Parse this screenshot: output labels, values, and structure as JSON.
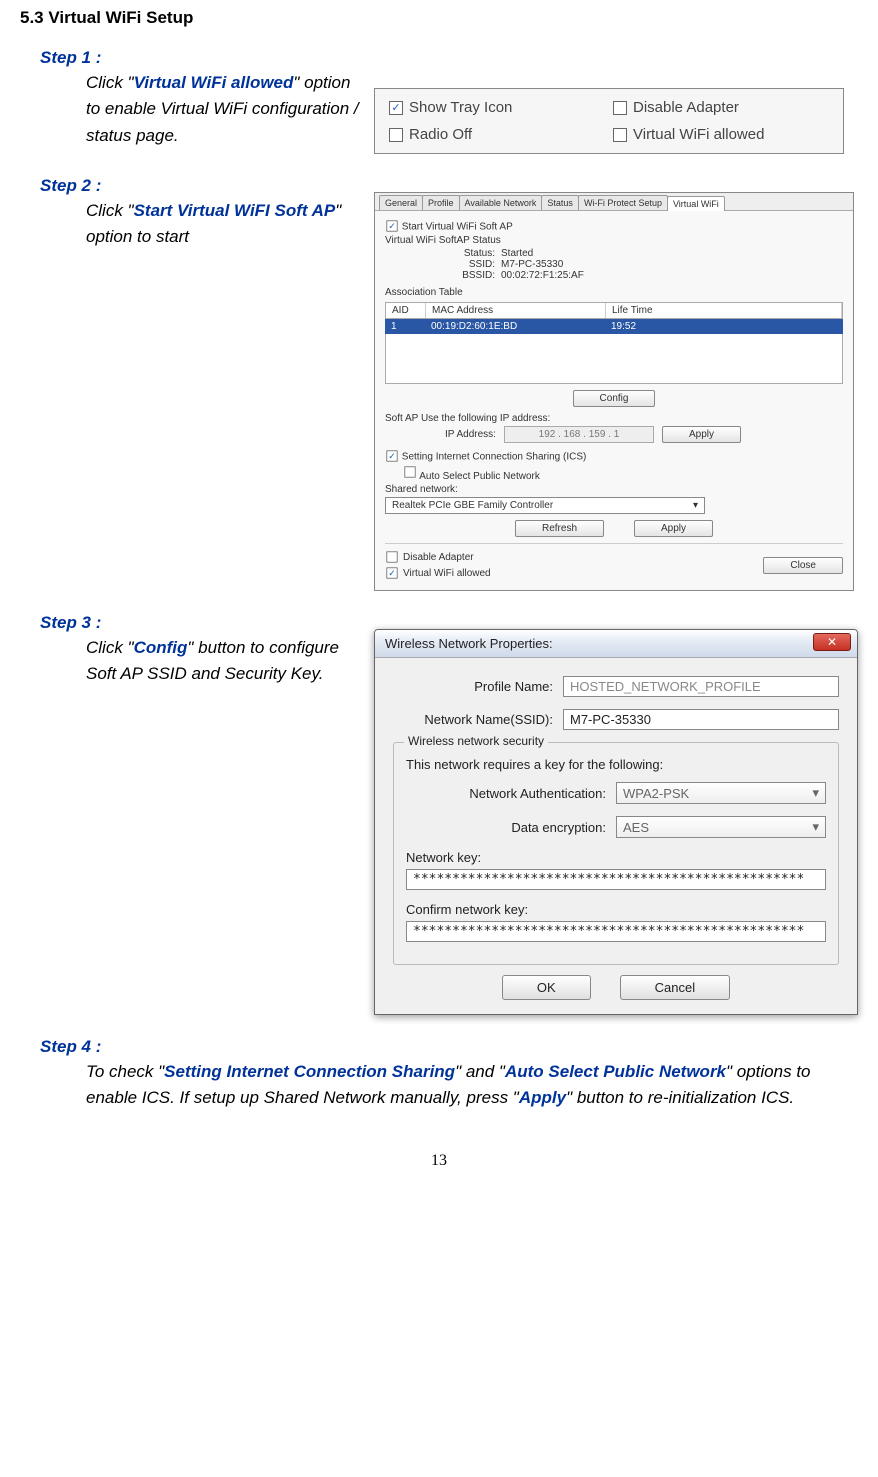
{
  "section_title": "5.3 Virtual WiFi Setup",
  "page_number": "13",
  "step1": {
    "label": "Step 1 :",
    "pre": "Click \"",
    "hl": "Virtual WiFi allowed",
    "post": "\" option to enable Virtual WiFi configuration / status page."
  },
  "fig1": {
    "opt1": "Show Tray Icon",
    "opt2": "Disable Adapter",
    "opt3": "Radio Off",
    "opt4": "Virtual WiFi allowed"
  },
  "step2": {
    "label": "Step 2 :",
    "pre": "Click \"",
    "hl": "Start Virtual WiFI Soft AP",
    "post": "\" option to start"
  },
  "fig2": {
    "tabs": [
      "General",
      "Profile",
      "Available Network",
      "Status",
      "Wi-Fi Protect Setup",
      "Virtual WiFi"
    ],
    "start_label": "Start Virtual WiFi Soft AP",
    "status_title": "Virtual WiFi SoftAP Status",
    "status": {
      "k": "Status:",
      "v": "Started"
    },
    "ssid": {
      "k": "SSID:",
      "v": "M7-PC-35330"
    },
    "bssid": {
      "k": "BSSID:",
      "v": "00:02:72:F1:25:AF"
    },
    "assoc_title": "Association Table",
    "table": {
      "headers": [
        "AID",
        "MAC Address",
        "Life Time"
      ],
      "row": [
        "1",
        "00:19:D2:60:1E:BD",
        "19:52"
      ]
    },
    "config_btn": "Config",
    "ip_label": "Soft AP Use the following IP address:",
    "ip_field_label": "IP Address:",
    "ip_value": "192 . 168 . 159 .  1",
    "apply_btn": "Apply",
    "ics_label": "Setting Internet Connection Sharing (ICS)",
    "auto_label": "Auto Select Public Network",
    "shared_label": "Shared network:",
    "shared_value": "Realtek PCIe GBE Family Controller",
    "refresh_btn": "Refresh",
    "apply2_btn": "Apply",
    "footer_opt1": "Disable Adapter",
    "footer_opt2": "Virtual WiFi allowed",
    "close_btn": "Close"
  },
  "step3": {
    "label": "Step 3 :",
    "pre": "Click \"",
    "hl": "Config",
    "post": "\" button to configure Soft AP SSID and Security Key."
  },
  "fig3": {
    "title": "Wireless Network Properties:",
    "profile_label": "Profile Name:",
    "profile_value": "HOSTED_NETWORK_PROFILE",
    "ssid_label": "Network Name(SSID):",
    "ssid_value": "M7-PC-35330",
    "group_title": "Wireless network security",
    "group_desc": "This network requires a key for the following:",
    "auth_label": "Network Authentication:",
    "auth_value": "WPA2-PSK",
    "enc_label": "Data encryption:",
    "enc_value": "AES",
    "key_label": "Network key:",
    "key_value": "**************************************************",
    "confirm_label": "Confirm network key:",
    "confirm_value": "**************************************************",
    "ok_btn": "OK",
    "cancel_btn": "Cancel"
  },
  "step4": {
    "label": "Step 4 :",
    "t1": "To check \"",
    "h1": "Setting Internet Connection Sharing",
    "t2": "\" and \"",
    "h2": "Auto Select Public Network",
    "t3": "\" options to enable ICS. If setup up Shared Network manually, press \"",
    "h3": "Apply",
    "t4": "\" button to re-initialization ICS."
  }
}
